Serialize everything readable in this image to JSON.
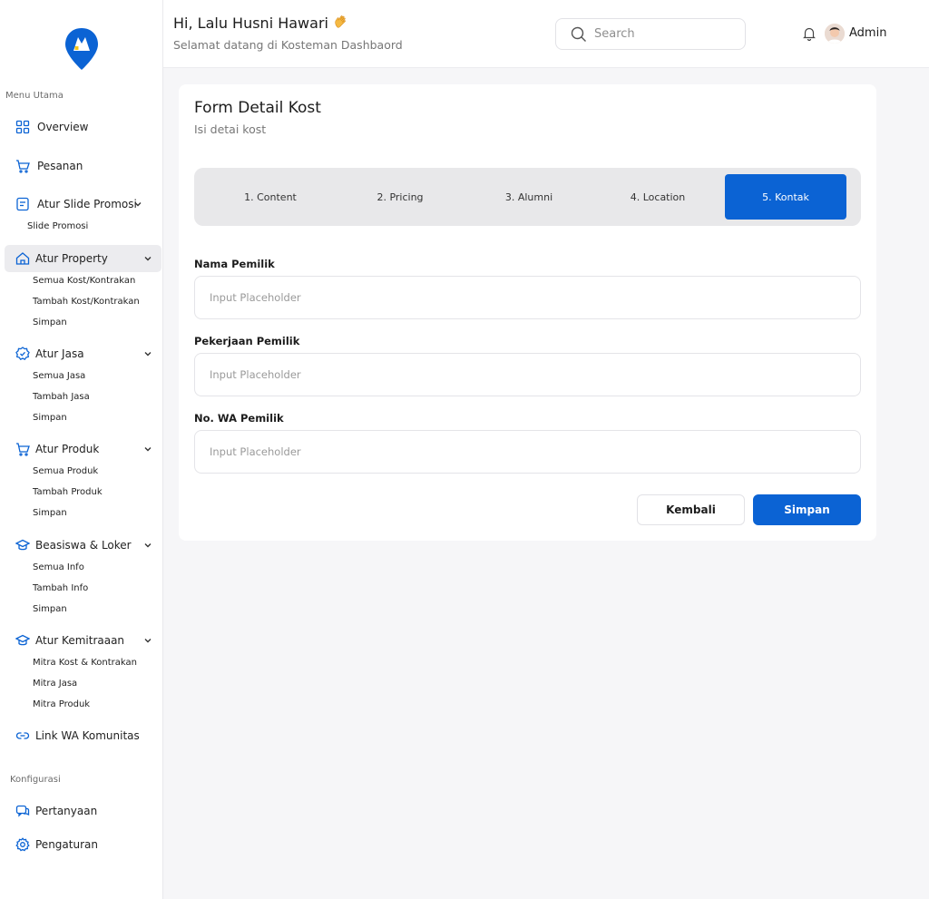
{
  "colors": {
    "accent": "#0b63d4",
    "active_nav_bg": "#ececef",
    "page_bg": "#f6f6f8"
  },
  "sidebar": {
    "menu_title": "Menu Utama",
    "config_title": "Konfigurasi",
    "overview": "Overview",
    "pesanan": "Pesanan",
    "slide": {
      "label": "Atur Slide Promosi",
      "subs": [
        "Slide Promosi"
      ]
    },
    "property": {
      "label": "Atur Property",
      "subs": [
        "Semua Kost/Kontrakan",
        "Tambah Kost/Kontrakan",
        "Simpan"
      ]
    },
    "jasa": {
      "label": "Atur Jasa",
      "subs": [
        "Semua Jasa",
        "Tambah Jasa",
        "Simpan"
      ]
    },
    "produk": {
      "label": "Atur Produk",
      "subs": [
        "Semua Produk",
        "Tambah Produk",
        "Simpan"
      ]
    },
    "beasiswa": {
      "label": "Beasiswa & Loker",
      "subs": [
        "Semua Info",
        "Tambah Info",
        "Simpan"
      ]
    },
    "kemitraan": {
      "label": "Atur Kemitraaan",
      "subs": [
        "Mitra Kost & Kontrakan",
        "Mitra Jasa",
        "Mitra Produk"
      ]
    },
    "link_wa": "Link WA Komunitas",
    "pertanyaan": "Pertanyaan",
    "pengaturan": "Pengaturan"
  },
  "header": {
    "greeting": "Hi, Lalu Husni Hawari",
    "subtitle": "Selamat datang di Kosteman Dashbaord",
    "search_placeholder": "Search",
    "user": "Admin"
  },
  "form": {
    "title": "Form Detail Kost",
    "subtitle": "Isi detai kost",
    "steps": [
      "1. Content",
      "2. Pricing",
      "3. Alumni",
      "4. Location",
      "5. Kontak"
    ],
    "active_step": 5,
    "fields": [
      {
        "label": "Nama Pemilik",
        "placeholder": "Input Placeholder"
      },
      {
        "label": "Pekerjaan Pemilik",
        "placeholder": "Input Placeholder"
      },
      {
        "label": "No. WA Pemilik",
        "placeholder": "Input Placeholder"
      }
    ],
    "back_label": "Kembali",
    "save_label": "Simpan"
  }
}
